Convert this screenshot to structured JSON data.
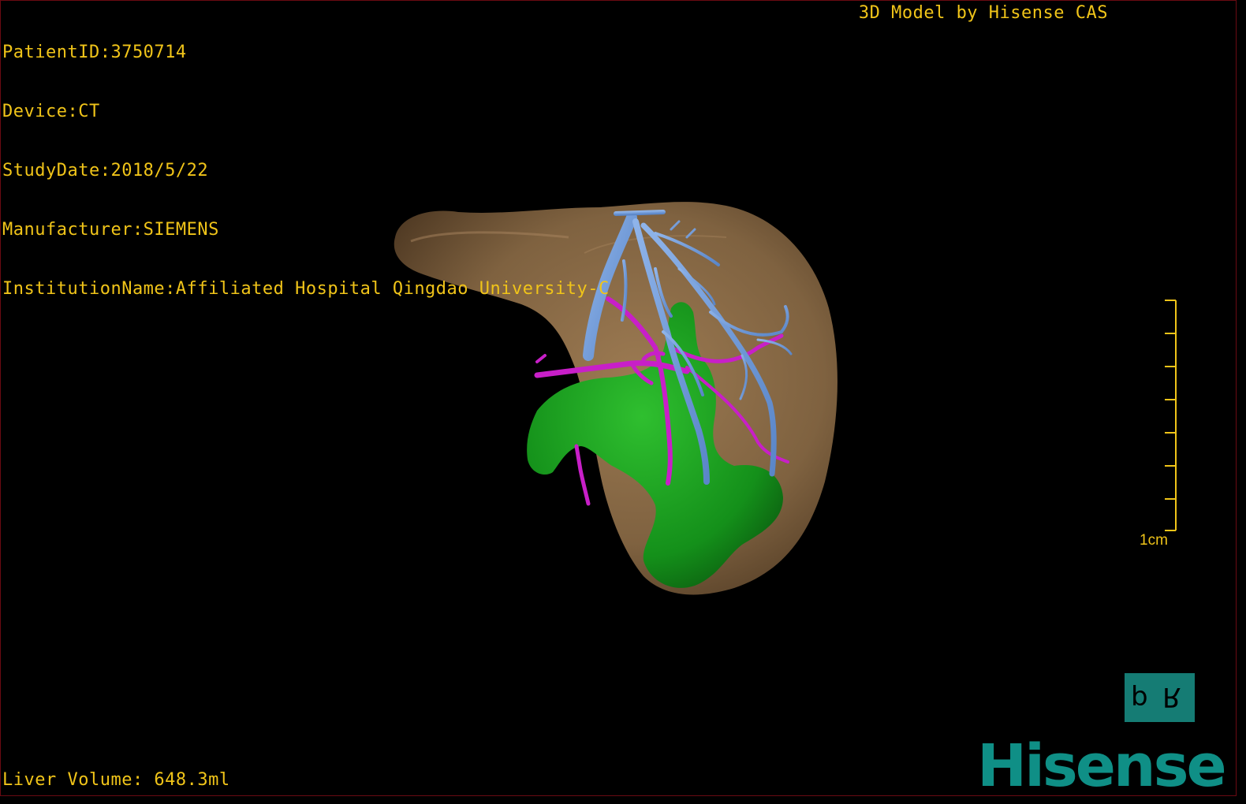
{
  "header_info": {
    "patient_id": "PatientID:3750714",
    "device": "Device:CT",
    "study_date": "StudyDate:2018/5/22",
    "manufacturer": "Manufacturer:SIEMENS",
    "institution": "InstitutionName:Affiliated Hospital Qingdao University-C"
  },
  "credit": "3D Model by Hisense CAS",
  "footer": {
    "liver_volume": "Liver Volume: 648.3ml"
  },
  "scale": {
    "label": "1cm"
  },
  "orientation": {
    "left_glyph": "d",
    "right_glyph": "R"
  },
  "brand": {
    "name": "Hisense"
  },
  "colors": {
    "overlay_text": "#f0c419",
    "liver": "#8a6a45",
    "veins": "#6f9bd8",
    "arteries": "#c81fc8",
    "portal": "#1b9a1b",
    "brand": "#0f8f86"
  }
}
